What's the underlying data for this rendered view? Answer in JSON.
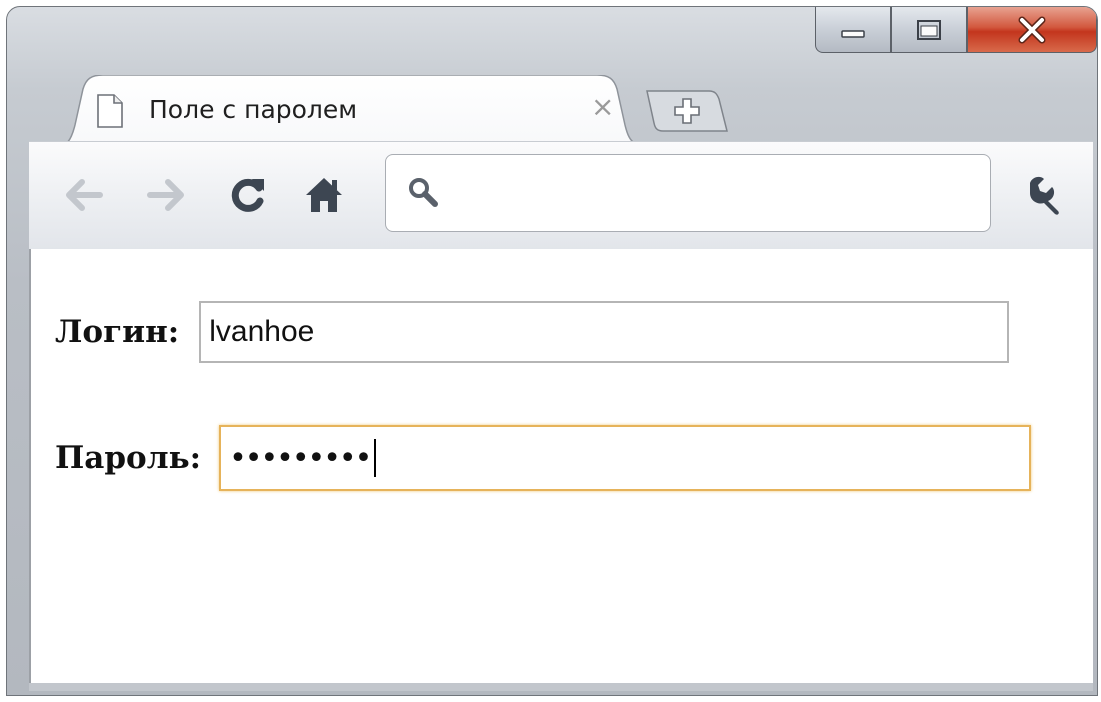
{
  "window": {
    "controls": [
      "minimize",
      "maximize",
      "close"
    ],
    "accent_close": "#c94a2e"
  },
  "tab": {
    "title": "Поле с паролем",
    "close_glyph": "×",
    "icon": "document-icon"
  },
  "toolbar": {
    "back_icon": "arrow-left-icon",
    "forward_icon": "arrow-right-icon",
    "reload_icon": "reload-icon",
    "home_icon": "home-icon",
    "search_icon": "search-icon",
    "wrench_icon": "wrench-icon",
    "address_value": ""
  },
  "form": {
    "login_label": "Логин:",
    "login_value": "lvanhoe",
    "password_label": "Пароль:",
    "password_masked": "•••••••••",
    "focus_color": "#e6b35a"
  }
}
